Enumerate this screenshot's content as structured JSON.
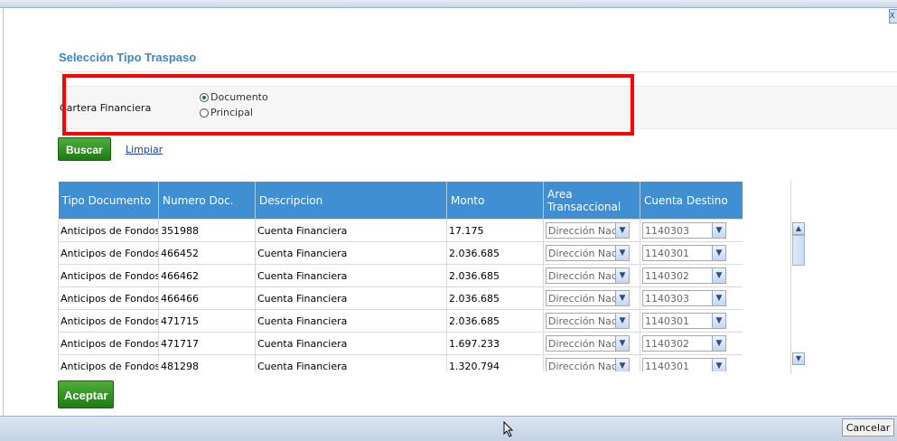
{
  "window": {
    "close_label": "X"
  },
  "title": "Selección Tipo Traspaso",
  "filter": {
    "label": "Cartera Financiera",
    "options": [
      {
        "label": "Documento",
        "checked": true
      },
      {
        "label": "Principal",
        "checked": false
      }
    ]
  },
  "actions": {
    "search_label": "Buscar",
    "clear_label": "Limpiar",
    "accept_label": "Aceptar",
    "cancel_label": "Cancelar"
  },
  "grid": {
    "headers": [
      "Tipo Documento",
      "Numero Doc.",
      "Descripcion",
      "Monto",
      "Area Transaccional",
      "Cuenta Destino"
    ],
    "rows": [
      {
        "tipo": "Anticipos de Fondos",
        "numero": "351988",
        "descripcion": "Cuenta Financiera",
        "monto": "17.175",
        "area": "Dirección Nac",
        "cuenta": "1140303"
      },
      {
        "tipo": "Anticipos de Fondos",
        "numero": "466452",
        "descripcion": "Cuenta Financiera",
        "monto": "2.036.685",
        "area": "Dirección Nac",
        "cuenta": "1140301"
      },
      {
        "tipo": "Anticipos de Fondos",
        "numero": "466462",
        "descripcion": "Cuenta Financiera",
        "monto": "2.036.685",
        "area": "Dirección Nac",
        "cuenta": "1140302"
      },
      {
        "tipo": "Anticipos de Fondos",
        "numero": "466466",
        "descripcion": "Cuenta Financiera",
        "monto": "2.036.685",
        "area": "Dirección Nac",
        "cuenta": "1140303"
      },
      {
        "tipo": "Anticipos de Fondos",
        "numero": "471715",
        "descripcion": "Cuenta Financiera",
        "monto": "2.036.685",
        "area": "Dirección Nac",
        "cuenta": "1140301"
      },
      {
        "tipo": "Anticipos de Fondos",
        "numero": "471717",
        "descripcion": "Cuenta Financiera",
        "monto": "1.697.233",
        "area": "Dirección Nac",
        "cuenta": "1140302"
      },
      {
        "tipo": "Anticipos de Fondos",
        "numero": "481298",
        "descripcion": "Cuenta Financiera",
        "monto": "1.320.794",
        "area": "Dirección Nac",
        "cuenta": "1140301"
      }
    ]
  },
  "colors": {
    "accent": "#3a86c8",
    "header_bg": "#3f8fd2",
    "button_green": "#2a8a1c",
    "highlight": "#ff0000"
  },
  "icons": {
    "dropdown": "chevron-down-icon",
    "scroll_up": "scroll-up-icon",
    "scroll_down": "scroll-down-icon",
    "cursor": "mouse-cursor-icon"
  }
}
